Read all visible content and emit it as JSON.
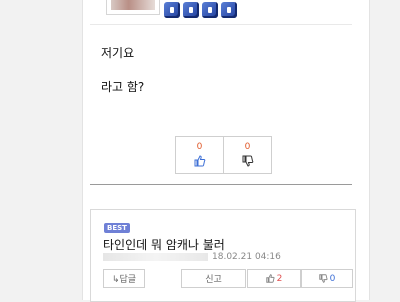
{
  "post": {
    "line1": "저기요",
    "line2": "라고 함?",
    "vote_up": "0",
    "vote_down": "0"
  },
  "comment": {
    "badge": "BEST",
    "text": "타인인데 뭐 암캐나 불러",
    "date": "18.02.21 04:16",
    "reply_label": "↳답글",
    "report_label": "신고",
    "likes": "2",
    "dislikes": "0"
  },
  "colors": {
    "count_orange": "#e0592a",
    "badge_blue": "#6f80d6",
    "like_red": "#e05050",
    "dislike_blue": "#3d6fd6"
  }
}
